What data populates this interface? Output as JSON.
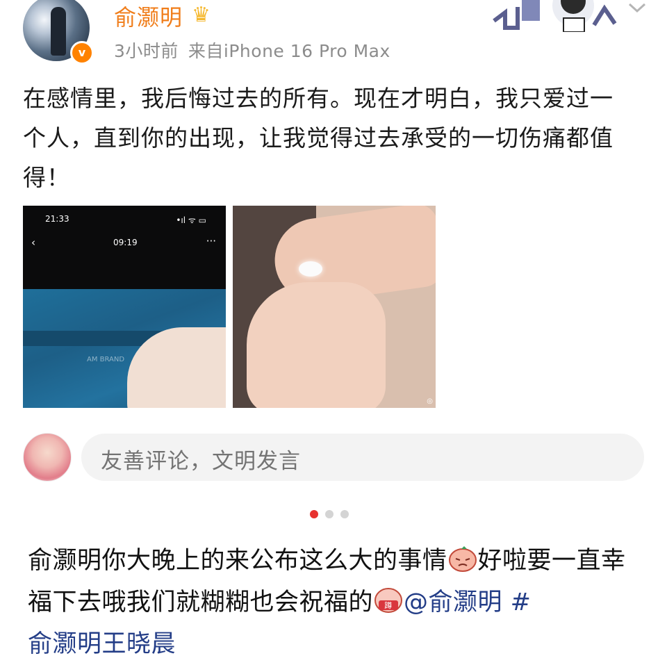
{
  "post": {
    "username": "俞灏明",
    "time": "3小时前",
    "source": "来自iPhone 16 Pro Max",
    "text": "在感情里，我后悔过去的所有。现在才明白，我只爱过一个人，直到你的出现，让我觉得过去承受的一切伤痛都值得！",
    "verified_badge": "v",
    "icons": [
      "verified-icon",
      "crown-icon",
      "chevron-down-icon"
    ]
  },
  "images": {
    "screenshot": {
      "status_time": "21:33",
      "status_icons": "•ıl ᯤ ▭",
      "nav_back": "‹",
      "nav_time": "09:19",
      "nav_more": "···",
      "box_label": "AM BRAND"
    },
    "hands_watermark": "◎"
  },
  "comment": {
    "placeholder": "友善评论，文明发言"
  },
  "pager": {
    "count": 3,
    "active": 0
  },
  "caption": {
    "part1": "俞灏明你大晚上的来公布这么大的事情",
    "part2": "好啦要一直幸福下去哦我们就糊糊也会祝福的",
    "mention": "@俞灏明",
    "hashtag_start": " #",
    "hashtag_text": "俞灏明王晓晨"
  },
  "colors": {
    "username": "#f07d1a",
    "meta": "#8c8c8c",
    "link": "#233d87",
    "active_dot": "#e7322f"
  }
}
